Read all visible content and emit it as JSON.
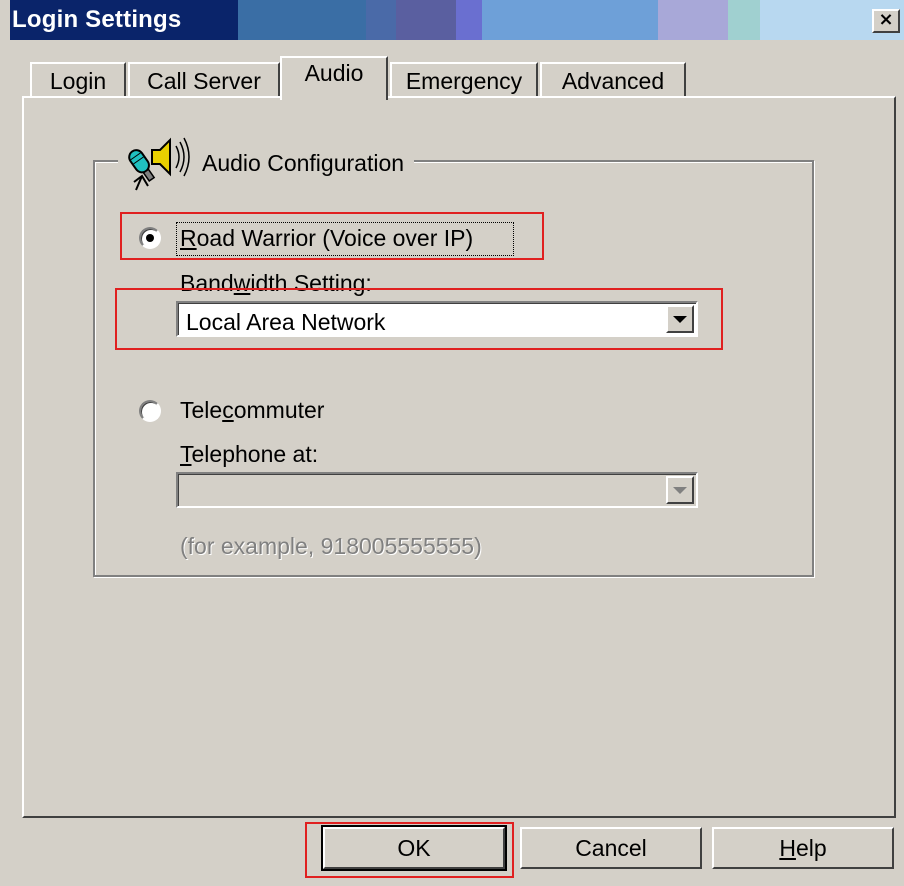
{
  "window": {
    "title": "Login Settings",
    "close_label": "×",
    "titlebar_colors": [
      "#3a6ea5",
      "#5a5fa0",
      "#6a6fd0",
      "#6ea0d8",
      "#8fb0e0",
      "#a8a8d8",
      "#a0d0d0",
      "#b8d8f0"
    ]
  },
  "tabs": [
    {
      "label": "Login",
      "active": false
    },
    {
      "label": "Call Server",
      "active": false
    },
    {
      "label": "Audio",
      "active": true
    },
    {
      "label": "Emergency",
      "active": false
    },
    {
      "label": "Advanced",
      "active": false
    }
  ],
  "audio": {
    "group_label": "Audio Configuration",
    "group_icon": "microphone-speaker-icon",
    "road_warrior": {
      "label": "Road Warrior (Voice over IP)",
      "access_key": "R",
      "selected": true
    },
    "bandwidth": {
      "label": "Bandwidth Setting:",
      "access_key": "w",
      "value": "Local Area Network"
    },
    "telecommuter": {
      "label": "Telecommuter",
      "access_key": "c",
      "selected": false
    },
    "telephone": {
      "label": "Telephone at:",
      "access_key": "T",
      "value": "",
      "enabled": false
    },
    "example": "(for example, 918005555555)"
  },
  "buttons": {
    "ok": "OK",
    "cancel": "Cancel",
    "help": "Help"
  },
  "highlight_color": "#e02020"
}
